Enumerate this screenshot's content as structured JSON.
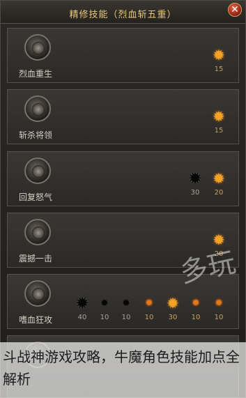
{
  "window": {
    "title": "精修技能（烈血斩五重）",
    "close_icon": "close-icon"
  },
  "skills": [
    {
      "name": "烈血重生",
      "nodes": [
        {
          "kind": "star",
          "cost": "15"
        }
      ]
    },
    {
      "name": "斩杀将领",
      "nodes": [
        {
          "kind": "star",
          "cost": "15"
        }
      ]
    },
    {
      "name": "回复怒气",
      "nodes": [
        {
          "kind": "dark",
          "cost": "30"
        },
        {
          "kind": "star",
          "cost": "20"
        }
      ]
    },
    {
      "name": "震撼一击",
      "nodes": [
        {
          "kind": "star",
          "cost": "20"
        }
      ]
    },
    {
      "name": "嗜血狂攻",
      "nodes": [
        {
          "kind": "dark",
          "cost": "40"
        },
        {
          "kind": "small-dark",
          "cost": "10"
        },
        {
          "kind": "small-dark",
          "cost": "10"
        },
        {
          "kind": "small-star",
          "cost": "10"
        },
        {
          "kind": "star",
          "cost": "30"
        },
        {
          "kind": "small-star",
          "cost": "10"
        },
        {
          "kind": "small-star",
          "cost": "10"
        }
      ]
    }
  ],
  "watermark": "多玩",
  "caption": "斗战神游戏攻略，牛魔角色技能加点全解析",
  "colors": {
    "accent": "#e8c77a",
    "star": "#f3a321",
    "cost": "#c8a060"
  }
}
